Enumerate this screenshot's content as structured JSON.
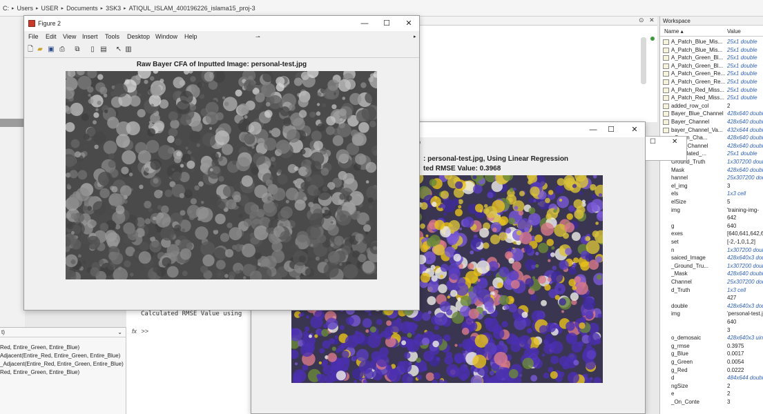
{
  "address": {
    "segments": [
      "C:",
      "Users",
      "USER",
      "Documents",
      "3SK3",
      "ATIQUL_ISLAM_400196226_islama15_proj-3"
    ]
  },
  "left_functions": {
    "header": "t)",
    "lines": [
      "Red, Entire_Green, Entire_Blue)",
      "Adjacent(Entire_Red, Entire_Green, Entire_Blue)",
      "_Adjacent(Entire_Red, Entire_Green, Entire_Blue)",
      "Red, Entire_Green, Entire_Blue)"
    ]
  },
  "command_window": {
    "text": "Calculated RMSE Value using",
    "prompt": ">>"
  },
  "figure2": {
    "window_title": "Figure 2",
    "menu": [
      "File",
      "Edit",
      "View",
      "Insert",
      "Tools",
      "Desktop",
      "Window",
      "Help"
    ],
    "plot_title": "Raw Bayer CFA of Inputted Image: personal-test.jpg"
  },
  "figure3": {
    "window_label": "p",
    "line1": ": personal-test.jpg, Using Linear Regression",
    "line2": "ted RMSE Value: 0.3968"
  },
  "workspace": {
    "title": "Workspace",
    "col_name": "Name",
    "col_value": "Value",
    "rows": [
      {
        "name": "A_Patch_Blue_Mis...",
        "value": "25x1 double",
        "blue": true
      },
      {
        "name": "A_Patch_Blue_Mis...",
        "value": "25x1 double",
        "blue": true
      },
      {
        "name": "A_Patch_Green_Bl...",
        "value": "25x1 double",
        "blue": true
      },
      {
        "name": "A_Patch_Green_Bl...",
        "value": "25x1 double",
        "blue": true
      },
      {
        "name": "A_Patch_Green_Re...",
        "value": "25x1 double",
        "blue": true
      },
      {
        "name": "A_Patch_Green_Re...",
        "value": "25x1 double",
        "blue": true
      },
      {
        "name": "A_Patch_Red_Miss...",
        "value": "25x1 double",
        "blue": true
      },
      {
        "name": "A_Patch_Red_Miss...",
        "value": "25x1 double",
        "blue": true
      },
      {
        "name": "added_row_col",
        "value": "2",
        "blue": false
      },
      {
        "name": "Bayer_Blue_Channel",
        "value": "428x640 double",
        "blue": true
      },
      {
        "name": "Bayer_Channel",
        "value": "428x640 double",
        "blue": true
      },
      {
        "name": "bayer_Channel_Va...",
        "value": "432x644 double",
        "blue": true
      },
      {
        "name": "_Green_Cha...",
        "value": "428x640 double",
        "blue": true
      },
      {
        "name": "_Red_Channel",
        "value": "428x640 double",
        "blue": true
      },
      {
        "name": "_Simulated_...",
        "value": "25x1 double",
        "blue": true
      },
      {
        "name": "Ground_Truth",
        "value": "1x307200 double",
        "blue": true
      },
      {
        "name": "Mask",
        "value": "428x640 double",
        "blue": true
      },
      {
        "name": "hannel",
        "value": "25x307200 double",
        "blue": true
      },
      {
        "name": "el_img",
        "value": "3",
        "blue": false
      },
      {
        "name": "els",
        "value": "1x3 cell",
        "blue": true
      },
      {
        "name": "elSize",
        "value": "5",
        "blue": false
      },
      {
        "name": "img",
        "value": "'training-img-",
        "blue": false
      },
      {
        "name": "",
        "value": "642",
        "blue": false
      },
      {
        "name": "g",
        "value": "640",
        "blue": false
      },
      {
        "name": "exes",
        "value": "[640,641,642,64",
        "blue": false
      },
      {
        "name": "set",
        "value": "[-2,-1,0,1,2]",
        "blue": false
      },
      {
        "name": "n",
        "value": "1x307200 double",
        "blue": true
      },
      {
        "name": "saiced_Image",
        "value": "428x640x3 dou",
        "blue": true
      },
      {
        "name": "_Ground_Tru...",
        "value": "1x307200 double",
        "blue": true
      },
      {
        "name": "_Mask",
        "value": "428x640 double",
        "blue": true
      },
      {
        "name": "Channel",
        "value": "25x307200 dou",
        "blue": true
      },
      {
        "name": "d_Truth",
        "value": "1x3 cell",
        "blue": true
      },
      {
        "name": "",
        "value": "427",
        "blue": false
      },
      {
        "name": "double",
        "value": "428x640x3 dou",
        "blue": true
      },
      {
        "name": "img",
        "value": "'personal-test.j",
        "blue": false
      },
      {
        "name": "",
        "value": "640",
        "blue": false
      },
      {
        "name": "",
        "value": "3",
        "blue": false
      },
      {
        "name": "o_demosaic",
        "value": "428x640x3 uint",
        "blue": true
      },
      {
        "name": "g_rmse",
        "value": "0.3975",
        "blue": false
      },
      {
        "name": "g_Blue",
        "value": "0.0017",
        "blue": false
      },
      {
        "name": "g_Green",
        "value": "0.0054",
        "blue": false
      },
      {
        "name": "g_Red",
        "value": "0.0222",
        "blue": false
      },
      {
        "name": "d",
        "value": "484x644 double",
        "blue": true
      },
      {
        "name": "ngSize",
        "value": "2",
        "blue": false
      },
      {
        "name": "e",
        "value": "2",
        "blue": false
      },
      {
        "name": "_On_Conte",
        "value": "3",
        "blue": false
      }
    ]
  },
  "colors": {
    "accent_blue": "#2f61b8",
    "figure_icon": "#c83a2a",
    "flower_purple": "#5a3fc0",
    "flower_yellow": "#e8c21a",
    "flower_pink": "#d97a8a"
  }
}
